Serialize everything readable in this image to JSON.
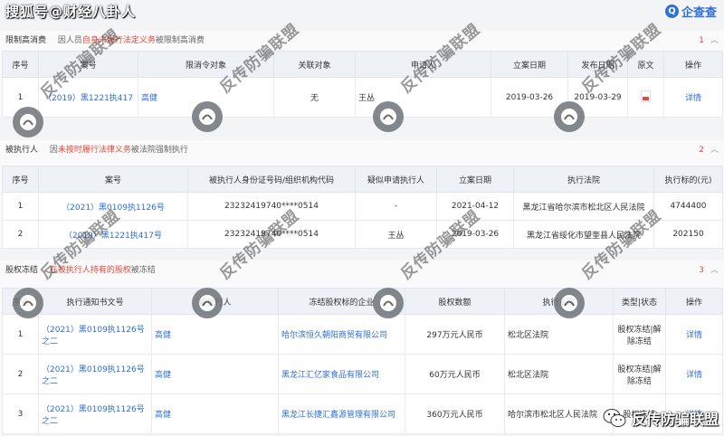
{
  "header": {
    "site_name": "搜狐号@财经八卦人",
    "logo_text": "企查查",
    "logo_glyph": "Q"
  },
  "sections": [
    {
      "title": "限制高消费",
      "desc_pre": "因人员",
      "desc_hl": "自身未履行法定义务",
      "desc_post": "被限制高消费",
      "count": "1",
      "columns": [
        "序号",
        "案号",
        "限消令对象",
        "关联对象",
        "申请人",
        "立案日期",
        "发布日期",
        "原文",
        "操作"
      ],
      "rows": [
        [
          "1",
          "（2019）黑1221执417",
          "高健",
          "无",
          "王丛",
          "2019-03-26",
          "2019-03-29",
          "",
          "详情"
        ]
      ]
    },
    {
      "title": "被执行人",
      "desc_pre": "因",
      "desc_hl": "未按时履行法律义务",
      "desc_post": "被法院强制执行",
      "count": "2",
      "columns": [
        "序号",
        "案号",
        "被执行人身份证号码/组织机构代码",
        "疑似申请执行人",
        "立案日期",
        "执行法院",
        "执行标的(元)"
      ],
      "rows": [
        [
          "1",
          "（2021）黑0109执1126号",
          "23232419740****0514",
          "-",
          "2021-04-12",
          "黑龙江省哈尔滨市松北区人民法院",
          "4744400"
        ],
        [
          "2",
          "（2019）黑1221执417号",
          "23232419740****0514",
          "王丛",
          "2019-03-26",
          "黑龙江省绥化市望奎县人民法院",
          "202150"
        ]
      ]
    },
    {
      "title": "股权冻结",
      "desc_pre": "",
      "desc_hl": "在被执行人持有的股权",
      "desc_post": "被冻结",
      "count": "3",
      "columns": [
        "序号",
        "执行通知书文号",
        "被执行人",
        "冻结股权标的企业",
        "股权数额",
        "执行法院",
        "类型|状态",
        "操作"
      ],
      "rows": [
        [
          "1",
          "（2021）黑0109执1126号之二",
          "高健",
          "哈尔滨恒久朝阳商贸有限公司",
          "297万元人民币",
          "松北区法院",
          "股权冻结|解除冻结",
          "详情"
        ],
        [
          "2",
          "（2021）黑0109执1126号之二",
          "高健",
          "黑龙江汇亿家食品有限公司",
          "60万元人民币",
          "松北区法院",
          "股权冻结|解除冻结",
          "详情"
        ],
        [
          "3",
          "（2021）黑0109执1126号之二",
          "高健",
          "黑龙江长捷汇鑫源管理有限公司",
          "360万元人民币",
          "哈尔滨市松北区人民法院",
          "股权冻结",
          "详情"
        ]
      ]
    }
  ],
  "watermark": {
    "text": "反传防骗联盟"
  },
  "footer": {
    "brand": "反传防骗联盟"
  },
  "icons": {
    "chevron": "chevron-up-icon",
    "pdf": "pdf-file-icon",
    "wechat": "wechat-icon"
  }
}
